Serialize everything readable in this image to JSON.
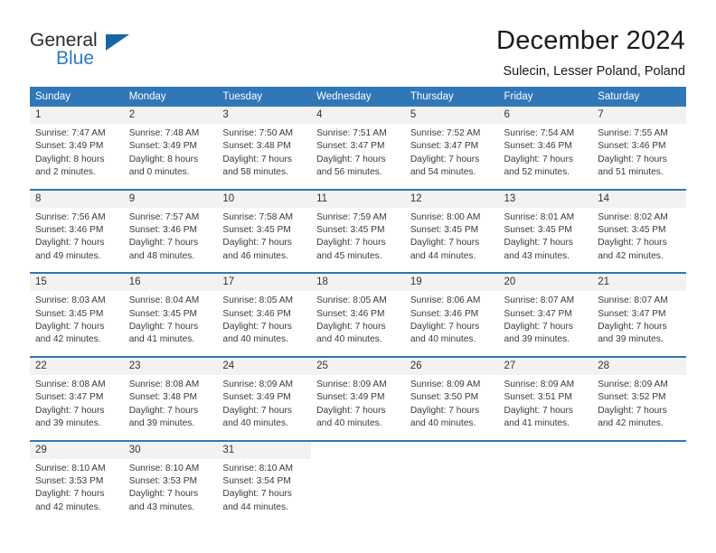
{
  "brand": {
    "name_top": "General",
    "name_bottom": "Blue",
    "triangle_color": "#1565a8",
    "blue_text_color": "#2b7cc4"
  },
  "header": {
    "title": "December 2024",
    "location": "Sulecin, Lesser Poland, Poland"
  },
  "theme": {
    "header_blue": "#3077b8",
    "daynum_bg": "#f2f2f2",
    "text": "#3a3a3a"
  },
  "weekdays": [
    "Sunday",
    "Monday",
    "Tuesday",
    "Wednesday",
    "Thursday",
    "Friday",
    "Saturday"
  ],
  "weeks": [
    [
      {
        "day": "1",
        "sunrise": "Sunrise: 7:47 AM",
        "sunset": "Sunset: 3:49 PM",
        "daylight_1": "Daylight: 8 hours",
        "daylight_2": "and 2 minutes."
      },
      {
        "day": "2",
        "sunrise": "Sunrise: 7:48 AM",
        "sunset": "Sunset: 3:49 PM",
        "daylight_1": "Daylight: 8 hours",
        "daylight_2": "and 0 minutes."
      },
      {
        "day": "3",
        "sunrise": "Sunrise: 7:50 AM",
        "sunset": "Sunset: 3:48 PM",
        "daylight_1": "Daylight: 7 hours",
        "daylight_2": "and 58 minutes."
      },
      {
        "day": "4",
        "sunrise": "Sunrise: 7:51 AM",
        "sunset": "Sunset: 3:47 PM",
        "daylight_1": "Daylight: 7 hours",
        "daylight_2": "and 56 minutes."
      },
      {
        "day": "5",
        "sunrise": "Sunrise: 7:52 AM",
        "sunset": "Sunset: 3:47 PM",
        "daylight_1": "Daylight: 7 hours",
        "daylight_2": "and 54 minutes."
      },
      {
        "day": "6",
        "sunrise": "Sunrise: 7:54 AM",
        "sunset": "Sunset: 3:46 PM",
        "daylight_1": "Daylight: 7 hours",
        "daylight_2": "and 52 minutes."
      },
      {
        "day": "7",
        "sunrise": "Sunrise: 7:55 AM",
        "sunset": "Sunset: 3:46 PM",
        "daylight_1": "Daylight: 7 hours",
        "daylight_2": "and 51 minutes."
      }
    ],
    [
      {
        "day": "8",
        "sunrise": "Sunrise: 7:56 AM",
        "sunset": "Sunset: 3:46 PM",
        "daylight_1": "Daylight: 7 hours",
        "daylight_2": "and 49 minutes."
      },
      {
        "day": "9",
        "sunrise": "Sunrise: 7:57 AM",
        "sunset": "Sunset: 3:46 PM",
        "daylight_1": "Daylight: 7 hours",
        "daylight_2": "and 48 minutes."
      },
      {
        "day": "10",
        "sunrise": "Sunrise: 7:58 AM",
        "sunset": "Sunset: 3:45 PM",
        "daylight_1": "Daylight: 7 hours",
        "daylight_2": "and 46 minutes."
      },
      {
        "day": "11",
        "sunrise": "Sunrise: 7:59 AM",
        "sunset": "Sunset: 3:45 PM",
        "daylight_1": "Daylight: 7 hours",
        "daylight_2": "and 45 minutes."
      },
      {
        "day": "12",
        "sunrise": "Sunrise: 8:00 AM",
        "sunset": "Sunset: 3:45 PM",
        "daylight_1": "Daylight: 7 hours",
        "daylight_2": "and 44 minutes."
      },
      {
        "day": "13",
        "sunrise": "Sunrise: 8:01 AM",
        "sunset": "Sunset: 3:45 PM",
        "daylight_1": "Daylight: 7 hours",
        "daylight_2": "and 43 minutes."
      },
      {
        "day": "14",
        "sunrise": "Sunrise: 8:02 AM",
        "sunset": "Sunset: 3:45 PM",
        "daylight_1": "Daylight: 7 hours",
        "daylight_2": "and 42 minutes."
      }
    ],
    [
      {
        "day": "15",
        "sunrise": "Sunrise: 8:03 AM",
        "sunset": "Sunset: 3:45 PM",
        "daylight_1": "Daylight: 7 hours",
        "daylight_2": "and 42 minutes."
      },
      {
        "day": "16",
        "sunrise": "Sunrise: 8:04 AM",
        "sunset": "Sunset: 3:45 PM",
        "daylight_1": "Daylight: 7 hours",
        "daylight_2": "and 41 minutes."
      },
      {
        "day": "17",
        "sunrise": "Sunrise: 8:05 AM",
        "sunset": "Sunset: 3:46 PM",
        "daylight_1": "Daylight: 7 hours",
        "daylight_2": "and 40 minutes."
      },
      {
        "day": "18",
        "sunrise": "Sunrise: 8:05 AM",
        "sunset": "Sunset: 3:46 PM",
        "daylight_1": "Daylight: 7 hours",
        "daylight_2": "and 40 minutes."
      },
      {
        "day": "19",
        "sunrise": "Sunrise: 8:06 AM",
        "sunset": "Sunset: 3:46 PM",
        "daylight_1": "Daylight: 7 hours",
        "daylight_2": "and 40 minutes."
      },
      {
        "day": "20",
        "sunrise": "Sunrise: 8:07 AM",
        "sunset": "Sunset: 3:47 PM",
        "daylight_1": "Daylight: 7 hours",
        "daylight_2": "and 39 minutes."
      },
      {
        "day": "21",
        "sunrise": "Sunrise: 8:07 AM",
        "sunset": "Sunset: 3:47 PM",
        "daylight_1": "Daylight: 7 hours",
        "daylight_2": "and 39 minutes."
      }
    ],
    [
      {
        "day": "22",
        "sunrise": "Sunrise: 8:08 AM",
        "sunset": "Sunset: 3:47 PM",
        "daylight_1": "Daylight: 7 hours",
        "daylight_2": "and 39 minutes."
      },
      {
        "day": "23",
        "sunrise": "Sunrise: 8:08 AM",
        "sunset": "Sunset: 3:48 PM",
        "daylight_1": "Daylight: 7 hours",
        "daylight_2": "and 39 minutes."
      },
      {
        "day": "24",
        "sunrise": "Sunrise: 8:09 AM",
        "sunset": "Sunset: 3:49 PM",
        "daylight_1": "Daylight: 7 hours",
        "daylight_2": "and 40 minutes."
      },
      {
        "day": "25",
        "sunrise": "Sunrise: 8:09 AM",
        "sunset": "Sunset: 3:49 PM",
        "daylight_1": "Daylight: 7 hours",
        "daylight_2": "and 40 minutes."
      },
      {
        "day": "26",
        "sunrise": "Sunrise: 8:09 AM",
        "sunset": "Sunset: 3:50 PM",
        "daylight_1": "Daylight: 7 hours",
        "daylight_2": "and 40 minutes."
      },
      {
        "day": "27",
        "sunrise": "Sunrise: 8:09 AM",
        "sunset": "Sunset: 3:51 PM",
        "daylight_1": "Daylight: 7 hours",
        "daylight_2": "and 41 minutes."
      },
      {
        "day": "28",
        "sunrise": "Sunrise: 8:09 AM",
        "sunset": "Sunset: 3:52 PM",
        "daylight_1": "Daylight: 7 hours",
        "daylight_2": "and 42 minutes."
      }
    ],
    [
      {
        "day": "29",
        "sunrise": "Sunrise: 8:10 AM",
        "sunset": "Sunset: 3:53 PM",
        "daylight_1": "Daylight: 7 hours",
        "daylight_2": "and 42 minutes."
      },
      {
        "day": "30",
        "sunrise": "Sunrise: 8:10 AM",
        "sunset": "Sunset: 3:53 PM",
        "daylight_1": "Daylight: 7 hours",
        "daylight_2": "and 43 minutes."
      },
      {
        "day": "31",
        "sunrise": "Sunrise: 8:10 AM",
        "sunset": "Sunset: 3:54 PM",
        "daylight_1": "Daylight: 7 hours",
        "daylight_2": "and 44 minutes."
      },
      {
        "day": "",
        "sunrise": "",
        "sunset": "",
        "daylight_1": "",
        "daylight_2": ""
      },
      {
        "day": "",
        "sunrise": "",
        "sunset": "",
        "daylight_1": "",
        "daylight_2": ""
      },
      {
        "day": "",
        "sunrise": "",
        "sunset": "",
        "daylight_1": "",
        "daylight_2": ""
      },
      {
        "day": "",
        "sunrise": "",
        "sunset": "",
        "daylight_1": "",
        "daylight_2": ""
      }
    ]
  ]
}
